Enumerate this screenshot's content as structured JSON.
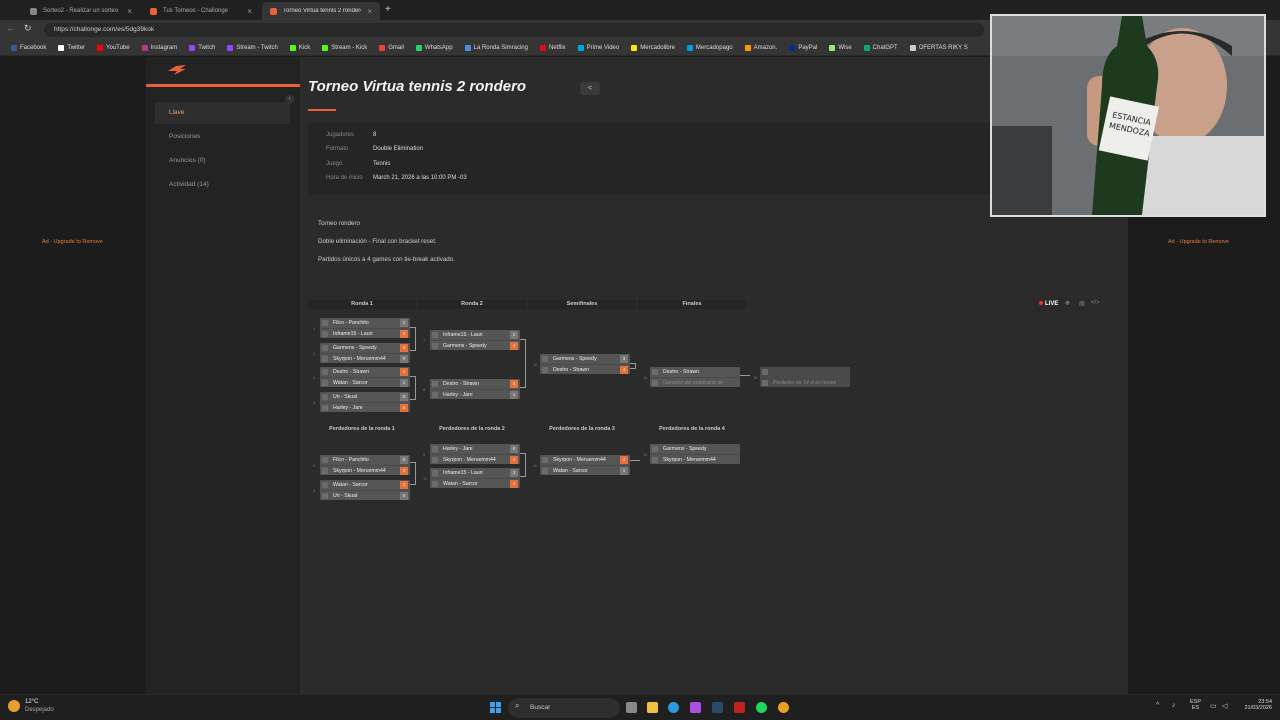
{
  "browser": {
    "tabs": [
      {
        "title": "Sorteo2 - Realizar un sorteo"
      },
      {
        "title": "Tus Torneos - Challonge"
      },
      {
        "title": "Torneo Virtua tennis 2 rondero - C"
      }
    ],
    "url": "https://challonge.com/es/5dg39kok",
    "bookmarks": [
      "Facebook",
      "Twitter",
      "YouTube",
      "Instagram",
      "Twitch",
      "Stream - Twitch",
      "Kick",
      "Stream - Kick",
      "Gmail",
      "WhatsApp",
      "La Ronda Simracing",
      "Netflix",
      "Prime Video",
      "Mercadolibre",
      "Mercadopago",
      "Amazon.",
      "PayPal",
      "Wise",
      "ChatGPT",
      "OFERTAS RIKY S"
    ],
    "bookmark_colors": [
      "#3b5998",
      "#ffffff",
      "#ff0000",
      "#c13584",
      "#9146ff",
      "#9146ff",
      "#53fc18",
      "#53fc18",
      "#ea4335",
      "#25d366",
      "#4a90d9",
      "#e50914",
      "#00a8e1",
      "#ffe600",
      "#009ee3",
      "#ff9900",
      "#003087",
      "#9fe870",
      "#10a37f",
      "#cccccc"
    ]
  },
  "ads": {
    "left": "Ad - Upgrade to Remove",
    "right": "Ad - Upgrade to Remove"
  },
  "sidebar": {
    "items": [
      {
        "label": "Llave"
      },
      {
        "label": "Posiciones"
      },
      {
        "label": "Anuncios (0)"
      },
      {
        "label": "Actividad (14)"
      }
    ]
  },
  "tournament": {
    "title": "Torneo Virtua tennis 2 rondero",
    "info": [
      {
        "label": "Jugadores",
        "value": "8"
      },
      {
        "label": "Formato",
        "value": "Double Elimination"
      },
      {
        "label": "Juego",
        "value": "Tennis"
      },
      {
        "label": "Hora de inicio",
        "value": "March 21, 2026 a las 10:00 PM -03"
      }
    ],
    "description": [
      "Torneo rondero",
      "Doble eliminación - Final con bracket reset.",
      "Partidos únicos a 4 games con tie-break activado."
    ]
  },
  "bracket": {
    "winners_headers": [
      "Ronda 1",
      "Ronda 2",
      "Semifinales",
      "Finales"
    ],
    "losers_headers": [
      "Perdedores de la ronda 1",
      "Perdedores de la ronda 2",
      "Perdedores de la ronda 3",
      "Perdedores de la ronda 4"
    ],
    "matches": [
      {
        "num": "1",
        "p1": "Filco - Panchito",
        "s1": "1",
        "p2": "Inframe15 - Lauri",
        "s2": "4",
        "win": 2
      },
      {
        "num": "2",
        "p1": "Garmens - Speedy",
        "s1": "4",
        "p2": "Skyrpon - Meruemm44",
        "s2": "0",
        "win": 1
      },
      {
        "num": "3",
        "p1": "Destro - Strawn",
        "s1": "4",
        "p2": "Watan - Sarcor",
        "s2": "1",
        "win": 1
      },
      {
        "num": "4",
        "p1": "Uri - Skual",
        "s1": "0",
        "p2": "Harley - Jare",
        "s2": "4",
        "win": 2
      },
      {
        "num": "7",
        "p1": "Inframe15 - Lauri",
        "s1": "1",
        "p2": "Garmens - Speedy",
        "s2": "4",
        "win": 2
      },
      {
        "num": "8",
        "p1": "Destro - Strawn",
        "s1": "4",
        "p2": "Harley - Jare",
        "s2": "1",
        "win": 1
      },
      {
        "num": "10",
        "p1": "Garmens - Speedy",
        "s1": "3",
        "p2": "Destro - Strawn",
        "s2": "4",
        "win": 2
      },
      {
        "num": "14",
        "p1": "Destro - Strawn",
        "s1": "",
        "p2": "Ganador del cuadrante de",
        "s2": "",
        "win": 0
      },
      {
        "num": "15",
        "p1": "",
        "s1": "",
        "p2": "Perdedor de 14 si es neces",
        "s2": "",
        "win": 0
      },
      {
        "num": "5",
        "p1": "Filco - Panchito",
        "s1": "0",
        "p2": "Skyrpon - Meruemm44",
        "s2": "4",
        "win": 2
      },
      {
        "num": "6",
        "p1": "Watan - Sarcor",
        "s1": "4",
        "p2": "Uri - Skual",
        "s2": "0",
        "win": 1
      },
      {
        "num": "9",
        "p1": "Harley - Jare",
        "s1": "0",
        "p2": "Skyrpon - Meruemm44",
        "s2": "4",
        "win": 2
      },
      {
        "num": "10",
        "p1": "Inframe15 - Lauri",
        "s1": "3",
        "p2": "Watan - Sarcor",
        "s2": "4",
        "win": 2
      },
      {
        "num": "11",
        "p1": "Skyrpon - Meruemm44",
        "s1": "4",
        "p2": "Watan - Sarcor",
        "s2": "1",
        "win": 1
      },
      {
        "num": "12",
        "p1": "Garmens - Speedy",
        "s1": "",
        "p2": "Skyrpon - Meruemm44",
        "s2": "",
        "win": 0
      }
    ]
  },
  "live": {
    "label": "LIVE"
  },
  "taskbar": {
    "temp": "12°C",
    "weather": "Despejado",
    "search": "Buscar",
    "lang1": "ESP",
    "lang2": "ES",
    "time": "23:54",
    "date": "21/03/2026"
  },
  "webcam": {
    "bottle_text1": "ESTANCIA",
    "bottle_text2": "MENDOZA"
  }
}
